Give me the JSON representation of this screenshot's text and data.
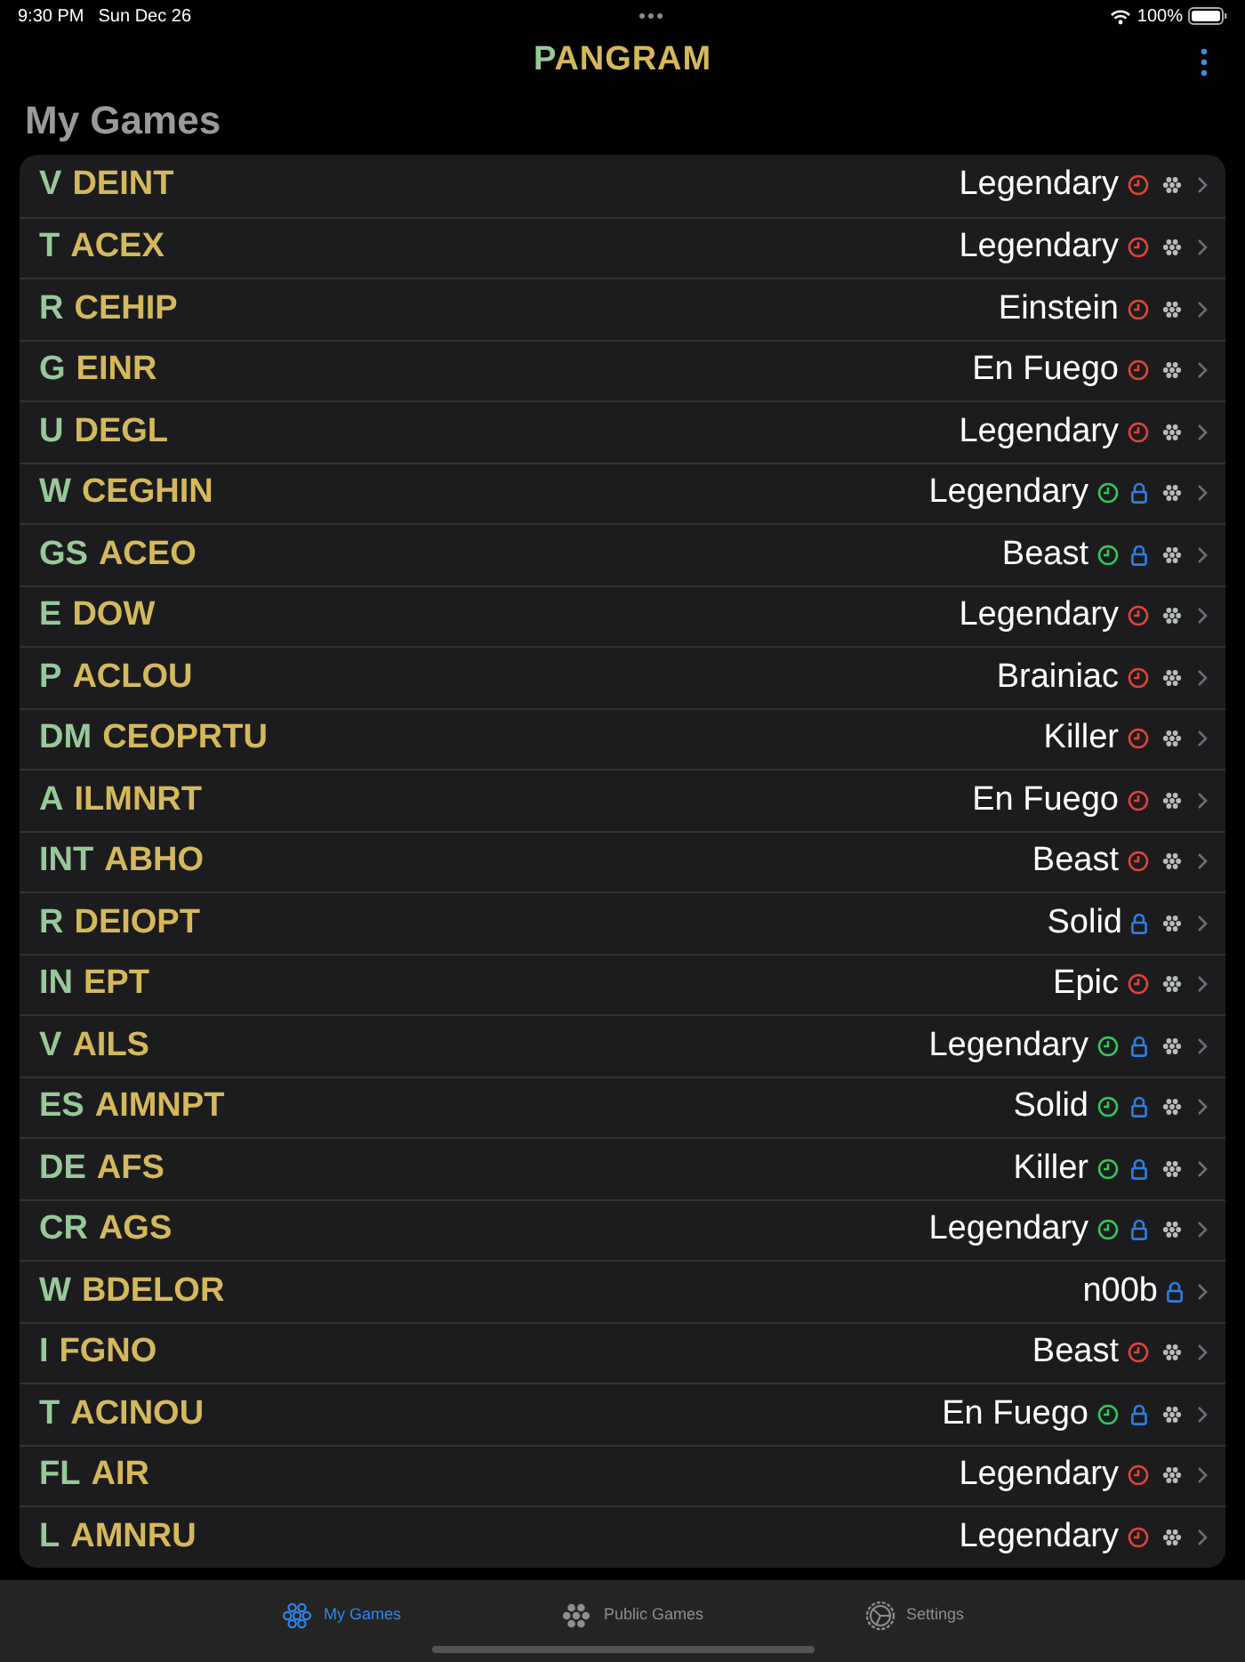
{
  "status_bar": {
    "time": "9:30 PM",
    "date": "Sun Dec 26",
    "battery": "100%"
  },
  "header": {
    "title_prefix": "P",
    "title_rest": "ANGRAM"
  },
  "section_title": "My Games",
  "games": [
    {
      "center": "V",
      "letters": "DEINT",
      "rank": "Legendary",
      "clock": {
        "color": "#e0443a"
      },
      "locked": false,
      "shared": true
    },
    {
      "center": "T",
      "letters": "ACEX",
      "rank": "Legendary",
      "clock": {
        "color": "#e0443a"
      },
      "locked": false,
      "shared": true
    },
    {
      "center": "R",
      "letters": "CEHIP",
      "rank": "Einstein",
      "clock": {
        "color": "#e0443a"
      },
      "locked": false,
      "shared": true
    },
    {
      "center": "G",
      "letters": "EINR",
      "rank": "En Fuego",
      "clock": {
        "color": "#e0443a"
      },
      "locked": false,
      "shared": true
    },
    {
      "center": "U",
      "letters": "DEGL",
      "rank": "Legendary",
      "clock": {
        "color": "#e0443a"
      },
      "locked": false,
      "shared": true
    },
    {
      "center": "W",
      "letters": "CEGHIN",
      "rank": "Legendary",
      "clock": {
        "color": "#34c759"
      },
      "locked": true,
      "shared": true
    },
    {
      "center": "GS",
      "letters": "ACEO",
      "rank": "Beast",
      "clock": {
        "color": "#34c759"
      },
      "locked": true,
      "shared": true
    },
    {
      "center": "E",
      "letters": "DOW",
      "rank": "Legendary",
      "clock": {
        "color": "#e0443a"
      },
      "locked": false,
      "shared": true
    },
    {
      "center": "P",
      "letters": "ACLOU",
      "rank": "Brainiac",
      "clock": {
        "color": "#e0443a"
      },
      "locked": false,
      "shared": true
    },
    {
      "center": "DM",
      "letters": "CEOPRTU",
      "rank": "Killer",
      "clock": {
        "color": "#e0443a"
      },
      "locked": false,
      "shared": true
    },
    {
      "center": "A",
      "letters": "ILMNRT",
      "rank": "En Fuego",
      "clock": {
        "color": "#e0443a"
      },
      "locked": false,
      "shared": true
    },
    {
      "center": "INT",
      "letters": "ABHO",
      "rank": "Beast",
      "clock": {
        "color": "#e0443a"
      },
      "locked": false,
      "shared": true
    },
    {
      "center": "R",
      "letters": "DEIOPT",
      "rank": "Solid",
      "locked": true,
      "shared": true
    },
    {
      "center": "IN",
      "letters": "EPT",
      "rank": "Epic",
      "clock": {
        "color": "#e0443a"
      },
      "locked": false,
      "shared": true
    },
    {
      "center": "V",
      "letters": "AILS",
      "rank": "Legendary",
      "clock": {
        "color": "#34c759"
      },
      "locked": true,
      "shared": true
    },
    {
      "center": "ES",
      "letters": "AIMNPT",
      "rank": "Solid",
      "clock": {
        "color": "#34c759"
      },
      "locked": true,
      "shared": true
    },
    {
      "center": "DE",
      "letters": "AFS",
      "rank": "Killer",
      "clock": {
        "color": "#34c759"
      },
      "locked": true,
      "shared": true
    },
    {
      "center": "CR",
      "letters": "AGS",
      "rank": "Legendary",
      "clock": {
        "color": "#34c759"
      },
      "locked": true,
      "shared": true
    },
    {
      "center": "W",
      "letters": "BDELOR",
      "rank": "n00b",
      "locked": true,
      "shared": false
    },
    {
      "center": "I",
      "letters": "FGNO",
      "rank": "Beast",
      "clock": {
        "color": "#e0443a"
      },
      "locked": false,
      "shared": true
    },
    {
      "center": "T",
      "letters": "ACINOU",
      "rank": "En Fuego",
      "clock": {
        "color": "#34c759"
      },
      "locked": true,
      "shared": true
    },
    {
      "center": "FL",
      "letters": "AIR",
      "rank": "Legendary",
      "clock": {
        "color": "#e0443a"
      },
      "locked": false,
      "shared": true
    },
    {
      "center": "L",
      "letters": "AMNRU",
      "rank": "Legendary",
      "clock": {
        "color": "#e0443a"
      },
      "locked": false,
      "shared": true
    }
  ],
  "tab_bar": [
    {
      "label": "My Games",
      "selected": true
    },
    {
      "label": "Public Games",
      "selected": false
    },
    {
      "label": "Settings",
      "selected": false
    }
  ]
}
